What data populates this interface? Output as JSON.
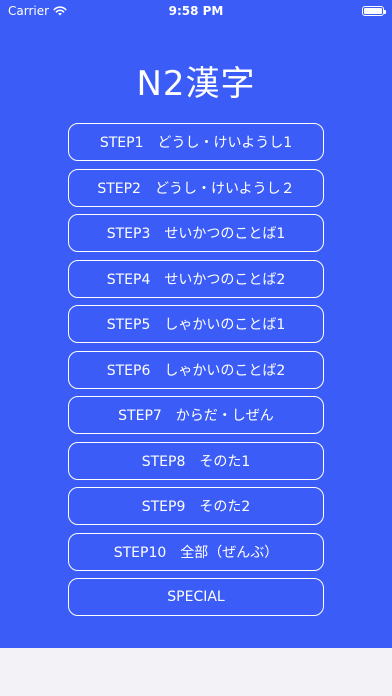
{
  "status_bar": {
    "carrier": "Carrier",
    "time": "9:58 PM",
    "wifi_icon": "wifi-icon",
    "battery_icon": "battery-icon"
  },
  "app": {
    "title": "N2漢字",
    "background_color": "#3b5cf6",
    "text_color": "#ffffff"
  },
  "steps": [
    {
      "label": "STEP1　どうし・けいようし1"
    },
    {
      "label": "STEP2　どうし・けいようし２"
    },
    {
      "label": "STEP3　せいかつのことば1"
    },
    {
      "label": "STEP4　せいかつのことば2"
    },
    {
      "label": "STEP5　しゃかいのことば1"
    },
    {
      "label": "STEP6　しゃかいのことば2"
    },
    {
      "label": "STEP7　からだ・しぜん"
    },
    {
      "label": "STEP8　そのた1"
    },
    {
      "label": "STEP9　そのた2"
    },
    {
      "label": "STEP10　全部（ぜんぶ）"
    },
    {
      "label": "SPECIAL"
    }
  ]
}
